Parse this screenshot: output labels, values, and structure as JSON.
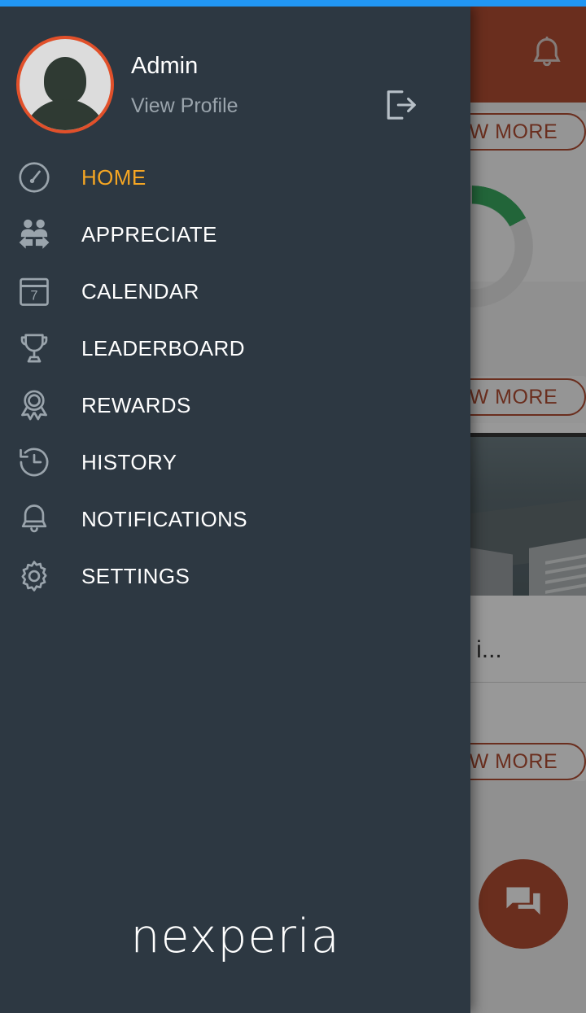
{
  "statusbar": {
    "color": "#2196f3"
  },
  "colors": {
    "drawer_bg": "#2d3842",
    "accent_orange": "#f5a623",
    "avatar_ring": "#e1502a",
    "brand_red": "#a83416",
    "progress_green": "#1e9e4a",
    "label_white": "#ffffff",
    "muted_gray": "#9aa4ac"
  },
  "drawer": {
    "profile": {
      "name": "Admin",
      "view_profile_label": "View Profile",
      "avatar_icon": "person-avatar-icon",
      "logout_icon": "logout-icon"
    },
    "menu": [
      {
        "label": "HOME",
        "icon": "dashboard-gauge-icon",
        "active": true
      },
      {
        "label": "APPRECIATE",
        "icon": "people-exchange-icon",
        "active": false
      },
      {
        "label": "CALENDAR",
        "icon": "calendar-icon",
        "active": false,
        "day": "7"
      },
      {
        "label": "LEADERBOARD",
        "icon": "trophy-icon",
        "active": false
      },
      {
        "label": "REWARDS",
        "icon": "award-medal-icon",
        "active": false
      },
      {
        "label": "HISTORY",
        "icon": "history-clock-icon",
        "active": false
      },
      {
        "label": "NOTIFICATIONS",
        "icon": "bell-icon",
        "active": false
      },
      {
        "label": "SETTINGS",
        "icon": "gear-icon",
        "active": false
      }
    ],
    "brand": {
      "name": "nexperia"
    }
  },
  "background_app": {
    "toolbar": {
      "bell_icon": "bell-icon",
      "color": "#a83416"
    },
    "cards": [
      {
        "view_more_label": "VIEW MORE"
      },
      {
        "view_more_label": "VIEW MORE"
      },
      {
        "view_more_label": "VIEW MORE"
      }
    ],
    "progress_donut": {
      "percent": 17,
      "color": "#1e9e4a"
    },
    "news": {
      "title": "ng plant i...",
      "image": "building-photo"
    },
    "fab": {
      "icon": "chat-forum-icon",
      "color": "#a83416"
    }
  }
}
